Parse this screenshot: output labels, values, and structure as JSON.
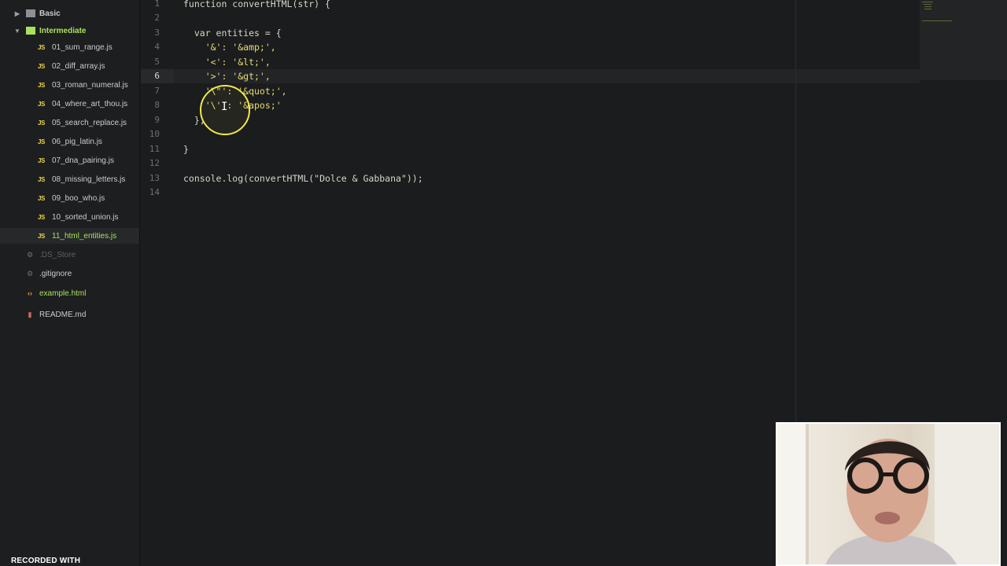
{
  "sidebar": {
    "folders": [
      {
        "label": "Basic",
        "expanded": false
      },
      {
        "label": "Intermediate",
        "expanded": true
      }
    ],
    "files": [
      {
        "label": "01_sum_range.js",
        "icon": "js-icon"
      },
      {
        "label": "02_diff_array.js",
        "icon": "js-icon"
      },
      {
        "label": "03_roman_numeral.js",
        "icon": "js-icon"
      },
      {
        "label": "04_where_art_thou.js",
        "icon": "js-icon"
      },
      {
        "label": "05_search_replace.js",
        "icon": "js-icon"
      },
      {
        "label": "06_pig_latin.js",
        "icon": "js-icon"
      },
      {
        "label": "07_dna_pairing.js",
        "icon": "js-icon"
      },
      {
        "label": "08_missing_letters.js",
        "icon": "js-icon"
      },
      {
        "label": "09_boo_who.js",
        "icon": "js-icon"
      },
      {
        "label": "10_sorted_union.js",
        "icon": "js-icon"
      },
      {
        "label": "11_html_entities.js",
        "icon": "js-icon",
        "selected": true
      }
    ],
    "root_files": [
      {
        "label": ".DS_Store",
        "icon": "gear-icon"
      },
      {
        "label": ".gitignore",
        "icon": "gear-icon"
      },
      {
        "label": "example.html",
        "icon": "code-icon"
      },
      {
        "label": "README.md",
        "icon": "book-icon"
      }
    ],
    "js_badge": "JS"
  },
  "editor": {
    "active_line": 6,
    "line_numbers": [
      "1",
      "2",
      "3",
      "4",
      "5",
      "6",
      "7",
      "8",
      "9",
      "10",
      "11",
      "12",
      "13",
      "14"
    ],
    "lines": [
      "function convertHTML(str) {",
      "",
      "  var entities = {",
      "    '&': '&amp;',",
      "    '<': '&lt;',",
      "    '>': '&gt;',",
      "    '\\\"': '&quot;',",
      "    '\\'': '&apos;'",
      "  };",
      "",
      "}",
      "",
      "console.log(convertHTML(\"Dolce & Gabbana\"));",
      ""
    ]
  },
  "recorder": {
    "label": "RECORDED WITH"
  },
  "colors": {
    "accent": "#a8e05f",
    "string": "#e6db74",
    "cursor_ring": "#f3e84a"
  }
}
